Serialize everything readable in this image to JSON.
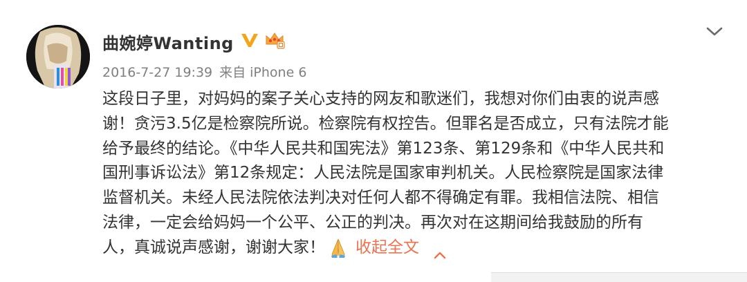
{
  "post": {
    "username": "曲婉婷Wanting",
    "timestamp": "2016-7-27 19:39",
    "source_prefix": "来自",
    "source_device": "iPhone 6",
    "verified_badge_color": "#f3a61d",
    "member_badge_color": "#f4a73a",
    "body_lines": [
      "这段日子里，对妈妈的案子关心支持的网友和歌迷们，我想对你们由衷的说声感",
      "谢！贪污3.5亿是检察院所说。检察院有权控告。但罪名是否成立，只有法院才能",
      "给予最终的结论。《中华人民共和国宪法》第123条、第129条和《中华人民共和",
      "国刑事诉讼法》第12条规定：人民法院是国家审判机关。人民检察院是国家法律",
      "监督机关。未经人民法院依法判决对任何人都不得确定有罪。我相信法院、相信",
      "法律，一定会给妈妈一个公平、公正的判决。再次对在这期间给我鼓励的所有"
    ],
    "last_line_text": "人，真诚说声感谢，谢谢大家！",
    "emoji_name": "pray-icon",
    "collapse_label": "收起全文",
    "link_color": "#eb7350",
    "text_color": "#333333",
    "meta_color": "#808080"
  }
}
